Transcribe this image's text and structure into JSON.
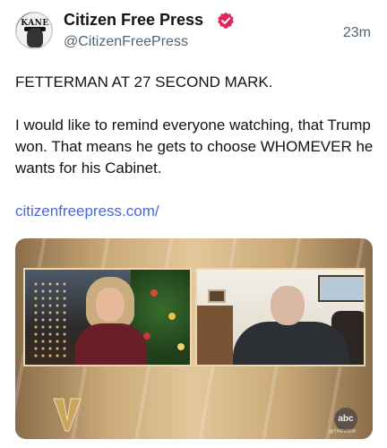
{
  "post": {
    "author_name": "Citizen Free Press",
    "handle": "@CitizenFreePress",
    "timestamp": "23m",
    "avatar_text": "KANE",
    "paragraphs": [
      "FETTERMAN AT 27 SECOND MARK.",
      "I would like to remind everyone watching, that Trump won. That means he gets to choose WHOMEVER he wants for his Cabinet."
    ],
    "link_text": "citizenfreepress.com/",
    "verified_badge_color": "#e0245e",
    "link_color": "#4a67d6"
  },
  "media": {
    "network_logo_text": "abc",
    "show_tag": "@THEVIEW"
  }
}
